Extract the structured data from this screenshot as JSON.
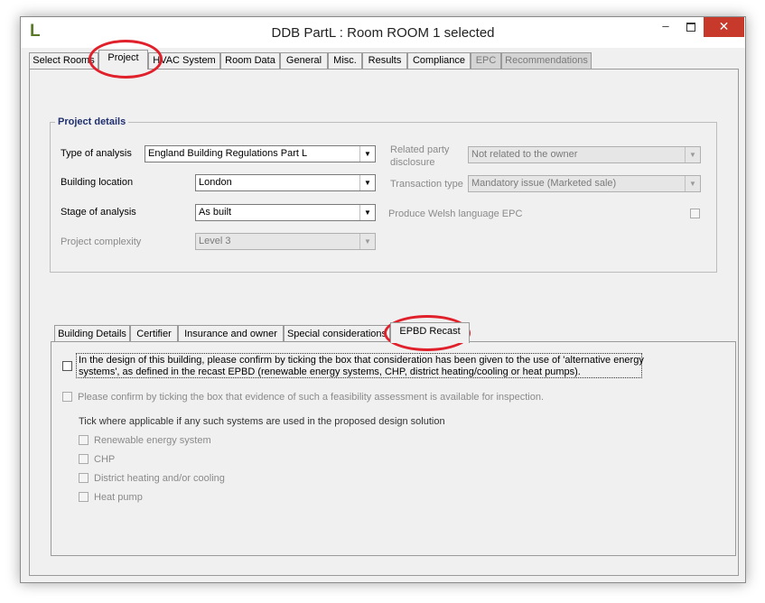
{
  "window": {
    "app_logo": "L",
    "title": "DDB PartL : Room ROOM 1 selected",
    "minimize": "–",
    "close": "✕"
  },
  "main_tabs": [
    {
      "label": "Select Rooms"
    },
    {
      "label": "Project"
    },
    {
      "label": "HVAC System"
    },
    {
      "label": "Room Data"
    },
    {
      "label": "General"
    },
    {
      "label": "Misc."
    },
    {
      "label": "Results"
    },
    {
      "label": "Compliance"
    },
    {
      "label": "EPC"
    },
    {
      "label": "Recommendations"
    }
  ],
  "project_details": {
    "legend": "Project details",
    "type_of_analysis": {
      "label": "Type of analysis",
      "value": "England Building Regulations Part L"
    },
    "building_location": {
      "label": "Building location",
      "value": "London"
    },
    "stage_of_analysis": {
      "label": "Stage of analysis",
      "value": "As built"
    },
    "project_complexity": {
      "label": "Project complexity",
      "value": "Level 3"
    },
    "related_party": {
      "label_line1": "Related party",
      "label_line2": "disclosure",
      "value": "Not related to the owner"
    },
    "transaction_type": {
      "label": "Transaction type",
      "value": "Mandatory issue (Marketed sale)"
    },
    "welsh_epc": {
      "label": "Produce Welsh language EPC",
      "checked": false
    }
  },
  "sub_tabs": [
    {
      "label": "Building Details"
    },
    {
      "label": "Certifier"
    },
    {
      "label": "Insurance and owner"
    },
    {
      "label": "Special considerations"
    },
    {
      "label": "EPBD Recast"
    }
  ],
  "epbd": {
    "consideration_line1": "In the design of this building, please confirm by ticking the box that consideration has been given to the use of 'alternative energy",
    "consideration_line2": "systems', as defined in the recast EPBD (renewable energy systems, CHP, district heating/cooling or heat pumps).",
    "feasibility_text": "Please confirm by ticking the box that evidence of such a feasibility assessment is available for inspection.",
    "tick_heading": "Tick where applicable if any such systems are used in the proposed design solution",
    "systems": [
      {
        "label": "Renewable energy system"
      },
      {
        "label": "CHP"
      },
      {
        "label": "District heating and/or cooling"
      },
      {
        "label": "Heat pump"
      }
    ]
  },
  "colors": {
    "highlight_ring": "#e0202a",
    "legend_text": "#1f2f6f",
    "close_button": "#c7392b"
  }
}
